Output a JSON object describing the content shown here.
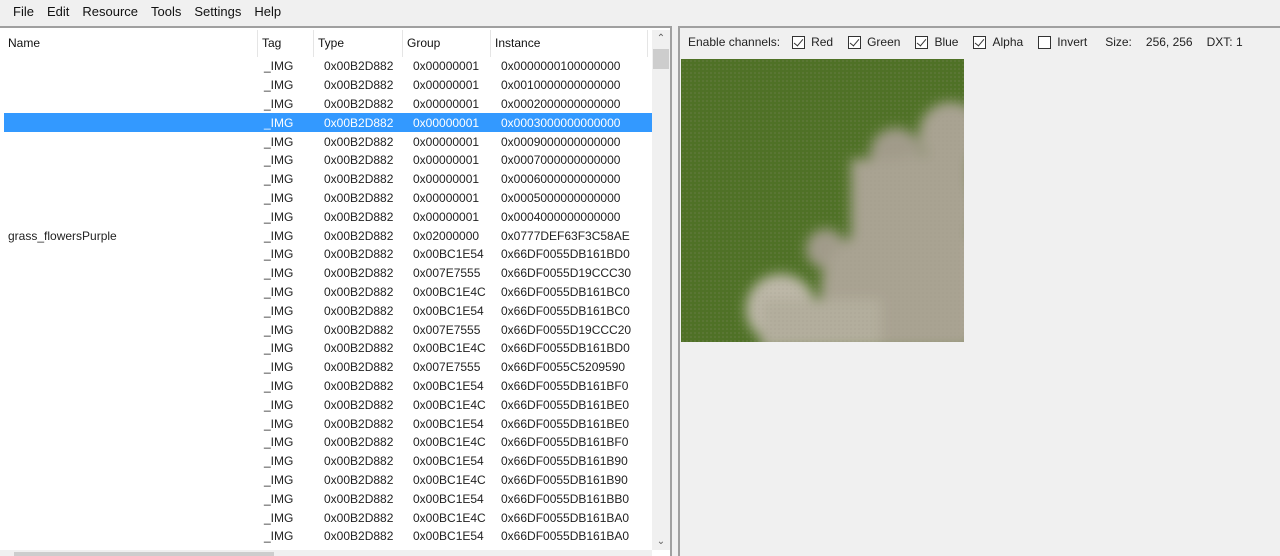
{
  "menu": [
    "File",
    "Edit",
    "Resource",
    "Tools",
    "Settings",
    "Help"
  ],
  "list": {
    "columns": [
      "Name",
      "Tag",
      "Type",
      "Group",
      "Instance"
    ],
    "selected_index": 3,
    "rows": [
      {
        "name": "",
        "tag": "_IMG",
        "type": "0x00B2D882",
        "group": "0x00000001",
        "instance": "0x0000000100000000"
      },
      {
        "name": "",
        "tag": "_IMG",
        "type": "0x00B2D882",
        "group": "0x00000001",
        "instance": "0x0010000000000000"
      },
      {
        "name": "",
        "tag": "_IMG",
        "type": "0x00B2D882",
        "group": "0x00000001",
        "instance": "0x0002000000000000"
      },
      {
        "name": "",
        "tag": "_IMG",
        "type": "0x00B2D882",
        "group": "0x00000001",
        "instance": "0x0003000000000000"
      },
      {
        "name": "",
        "tag": "_IMG",
        "type": "0x00B2D882",
        "group": "0x00000001",
        "instance": "0x0009000000000000"
      },
      {
        "name": "",
        "tag": "_IMG",
        "type": "0x00B2D882",
        "group": "0x00000001",
        "instance": "0x0007000000000000"
      },
      {
        "name": "",
        "tag": "_IMG",
        "type": "0x00B2D882",
        "group": "0x00000001",
        "instance": "0x0006000000000000"
      },
      {
        "name": "",
        "tag": "_IMG",
        "type": "0x00B2D882",
        "group": "0x00000001",
        "instance": "0x0005000000000000"
      },
      {
        "name": "",
        "tag": "_IMG",
        "type": "0x00B2D882",
        "group": "0x00000001",
        "instance": "0x0004000000000000"
      },
      {
        "name": "grass_flowersPurple",
        "tag": "_IMG",
        "type": "0x00B2D882",
        "group": "0x02000000",
        "instance": "0x0777DEF63F3C58AE"
      },
      {
        "name": "",
        "tag": "_IMG",
        "type": "0x00B2D882",
        "group": "0x00BC1E54",
        "instance": "0x66DF0055DB161BD0"
      },
      {
        "name": "",
        "tag": "_IMG",
        "type": "0x00B2D882",
        "group": "0x007E7555",
        "instance": "0x66DF0055D19CCC30"
      },
      {
        "name": "",
        "tag": "_IMG",
        "type": "0x00B2D882",
        "group": "0x00BC1E4C",
        "instance": "0x66DF0055DB161BC0"
      },
      {
        "name": "",
        "tag": "_IMG",
        "type": "0x00B2D882",
        "group": "0x00BC1E54",
        "instance": "0x66DF0055DB161BC0"
      },
      {
        "name": "",
        "tag": "_IMG",
        "type": "0x00B2D882",
        "group": "0x007E7555",
        "instance": "0x66DF0055D19CCC20"
      },
      {
        "name": "",
        "tag": "_IMG",
        "type": "0x00B2D882",
        "group": "0x00BC1E4C",
        "instance": "0x66DF0055DB161BD0"
      },
      {
        "name": "",
        "tag": "_IMG",
        "type": "0x00B2D882",
        "group": "0x007E7555",
        "instance": "0x66DF0055C5209590"
      },
      {
        "name": "",
        "tag": "_IMG",
        "type": "0x00B2D882",
        "group": "0x00BC1E54",
        "instance": "0x66DF0055DB161BF0"
      },
      {
        "name": "",
        "tag": "_IMG",
        "type": "0x00B2D882",
        "group": "0x00BC1E4C",
        "instance": "0x66DF0055DB161BE0"
      },
      {
        "name": "",
        "tag": "_IMG",
        "type": "0x00B2D882",
        "group": "0x00BC1E54",
        "instance": "0x66DF0055DB161BE0"
      },
      {
        "name": "",
        "tag": "_IMG",
        "type": "0x00B2D882",
        "group": "0x00BC1E4C",
        "instance": "0x66DF0055DB161BF0"
      },
      {
        "name": "",
        "tag": "_IMG",
        "type": "0x00B2D882",
        "group": "0x00BC1E54",
        "instance": "0x66DF0055DB161B90"
      },
      {
        "name": "",
        "tag": "_IMG",
        "type": "0x00B2D882",
        "group": "0x00BC1E4C",
        "instance": "0x66DF0055DB161B90"
      },
      {
        "name": "",
        "tag": "_IMG",
        "type": "0x00B2D882",
        "group": "0x00BC1E54",
        "instance": "0x66DF0055DB161BB0"
      },
      {
        "name": "",
        "tag": "_IMG",
        "type": "0x00B2D882",
        "group": "0x00BC1E4C",
        "instance": "0x66DF0055DB161BA0"
      },
      {
        "name": "",
        "tag": "_IMG",
        "type": "0x00B2D882",
        "group": "0x00BC1E54",
        "instance": "0x66DF0055DB161BA0"
      }
    ]
  },
  "scroll_icons": {
    "up": "chevron-up-icon",
    "down": "chevron-down-icon"
  },
  "viewer": {
    "enable_label": "Enable channels:",
    "channels": [
      {
        "label": "Red",
        "checked": true
      },
      {
        "label": "Green",
        "checked": true
      },
      {
        "label": "Blue",
        "checked": true
      },
      {
        "label": "Alpha",
        "checked": true
      },
      {
        "label": "Invert",
        "checked": false
      }
    ],
    "size_label": "Size:",
    "size_value": "256, 256",
    "dxt_label": "DXT: 1",
    "preview_colors": {
      "grass": "#4f7126",
      "stone": "#a9a392",
      "stone_light": "#bdb8a8"
    }
  },
  "colors": {
    "selection": "#3399ff",
    "accent_tick": "#f0a040"
  }
}
